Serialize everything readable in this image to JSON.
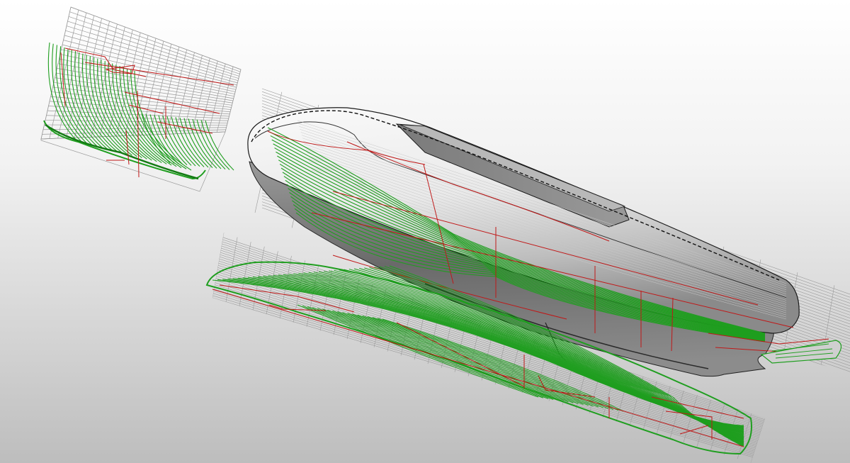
{
  "viewport": {
    "view": "perspective",
    "background": {
      "top": "#ffffff",
      "bottom": "#bdbdbd"
    },
    "colors": {
      "grid": "#9a9a9a",
      "waterline": "#1f9e1f",
      "station": "#c01818",
      "hull_outline": "#1a1a1a",
      "hull_shade_light": "#f7f7f7",
      "hull_shade_dark": "#6e6e6e"
    }
  },
  "objects": [
    {
      "id": "body-plan",
      "kind": "body-plan-section"
    },
    {
      "id": "hull-3d",
      "kind": "shaded-hull-model"
    },
    {
      "id": "half-breadth",
      "kind": "waterline-plan"
    }
  ]
}
